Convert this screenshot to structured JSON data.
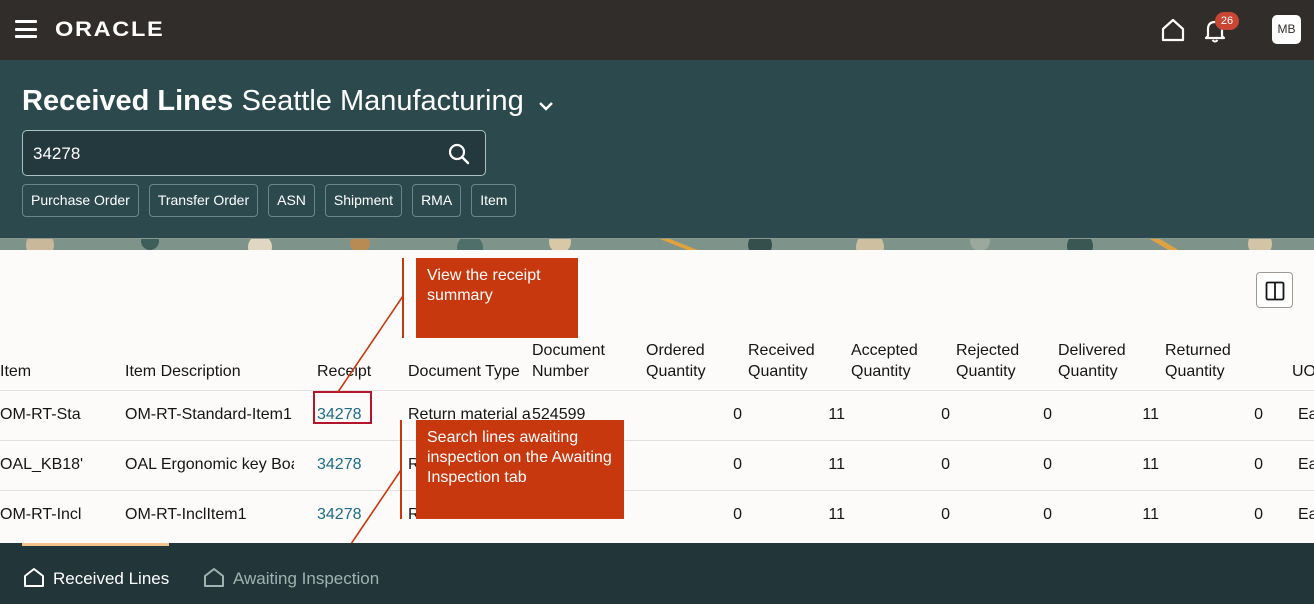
{
  "topbar": {
    "brand": "ORACLE",
    "notification_count": "26",
    "user_initials": "MB",
    "icons": [
      "menu-icon",
      "home-icon",
      "bell-icon"
    ]
  },
  "header": {
    "title": "Received Lines",
    "organization": "Seattle Manufacturing",
    "search_value": "34278",
    "chips": [
      "Purchase Order",
      "Transfer Order",
      "ASN",
      "Shipment",
      "RMA",
      "Item"
    ]
  },
  "table": {
    "headers": {
      "item": "Item",
      "item_description": "Item Description",
      "receipt": "Receipt",
      "document_type": "Document Type",
      "document_number": "Document Number",
      "ordered_quantity": "Ordered Quantity",
      "received_quantity": "Received Quantity",
      "accepted_quantity": "Accepted Quantity",
      "rejected_quantity": "Rejected Quantity",
      "delivered_quantity": "Delivered Quantity",
      "returned_quantity": "Returned Quantity",
      "uom": "UO"
    },
    "rows": [
      {
        "item": "OM-RT-Sta",
        "description": "OM-RT-Standard-Item1",
        "receipt": "34278",
        "doc_type": "Return material a",
        "doc_number": "524599",
        "ordered": "0",
        "received": "11",
        "accepted": "0",
        "rejected": "0",
        "delivered": "11",
        "returned": "0",
        "uom": "Ea"
      },
      {
        "item": "OAL_KB18'",
        "description": "OAL Ergonomic key Boa",
        "receipt": "34278",
        "doc_type": "R",
        "doc_number": "",
        "ordered": "0",
        "received": "11",
        "accepted": "0",
        "rejected": "0",
        "delivered": "11",
        "returned": "0",
        "uom": "Ea"
      },
      {
        "item": "OM-RT-Incl",
        "description": "OM-RT-InclItem1",
        "receipt": "34278",
        "doc_type": "R",
        "doc_number": "",
        "ordered": "0",
        "received": "11",
        "accepted": "0",
        "rejected": "0",
        "delivered": "11",
        "returned": "0",
        "uom": "Ea"
      }
    ]
  },
  "callouts": {
    "receipt_summary": "View the receipt summary",
    "awaiting_inspection": "Search lines awaiting inspection on the Awaiting Inspection tab"
  },
  "colors": {
    "topbar": "#312d2a",
    "header": "#2c4a4e",
    "callout": "#c8380e",
    "link": "#1f6b84",
    "bottombar": "#223538",
    "tab_indicator": "#f2c38a"
  },
  "bottom_tabs": {
    "received_lines": "Received Lines",
    "awaiting_inspection": "Awaiting Inspection"
  }
}
